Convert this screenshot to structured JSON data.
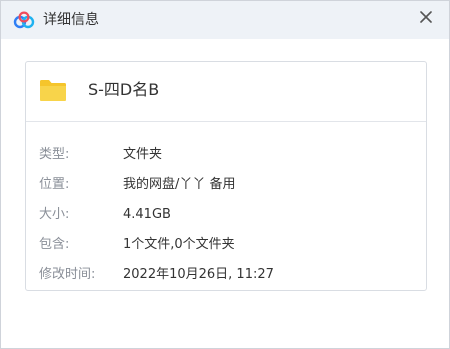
{
  "window": {
    "title": "详细信息",
    "close_icon": "close-icon",
    "logo_icon": "baidu-netdisk-cloud-icon"
  },
  "file": {
    "icon": "folder-icon",
    "folder_color": "#f5c52b",
    "name": "S-四D名B"
  },
  "details": [
    {
      "label": "类型:",
      "value": "文件夹"
    },
    {
      "label": "位置:",
      "value": "我的网盘/丫丫 备用"
    },
    {
      "label": "大小:",
      "value": "4.41GB"
    },
    {
      "label": "包含:",
      "value": "1个文件,0个文件夹"
    },
    {
      "label": "修改时间:",
      "value": "2022年10月26日, 11:27"
    }
  ]
}
